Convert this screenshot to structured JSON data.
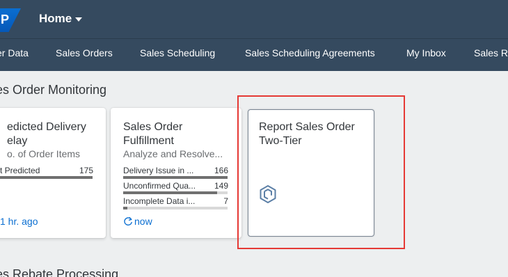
{
  "shell": {
    "logo_text": "P",
    "home_title": "Home"
  },
  "tabs": [
    {
      "label": "er Data"
    },
    {
      "label": "Sales Orders"
    },
    {
      "label": "Sales Scheduling"
    },
    {
      "label": "Sales Scheduling Agreements"
    },
    {
      "label": "My Inbox"
    },
    {
      "label": "Sales R"
    }
  ],
  "sections": [
    {
      "title": "es Order Monitoring"
    },
    {
      "title": "es Rebate Processing"
    }
  ],
  "tiles": [
    {
      "title_line1": "edicted Delivery",
      "title_line2": "elay",
      "subtitle": "o. of Order Items",
      "rows": [
        {
          "label": "t Predicted",
          "value": "175",
          "fill": 1.0
        }
      ],
      "footer": "1 hr. ago"
    },
    {
      "title_line1": "Sales Order",
      "title_line2": "Fulfillment",
      "subtitle": "Analyze and Resolve...",
      "rows": [
        {
          "label": "Delivery Issue in ...",
          "value": "166",
          "fill": 1.0
        },
        {
          "label": "Unconfirmed Qua...",
          "value": "149",
          "fill": 0.9
        },
        {
          "label": "Incomplete Data i...",
          "value": "7",
          "fill": 0.04
        }
      ],
      "footer_icon": "refresh-icon",
      "footer": "now"
    },
    {
      "title_line1": "Report Sales Order",
      "title_line2": "Two-Tier",
      "icon": "app-launcher-cube-icon"
    }
  ],
  "colors": {
    "shell": "#354a5f",
    "link": "#0a6ed1",
    "highlight": "#e53935"
  }
}
